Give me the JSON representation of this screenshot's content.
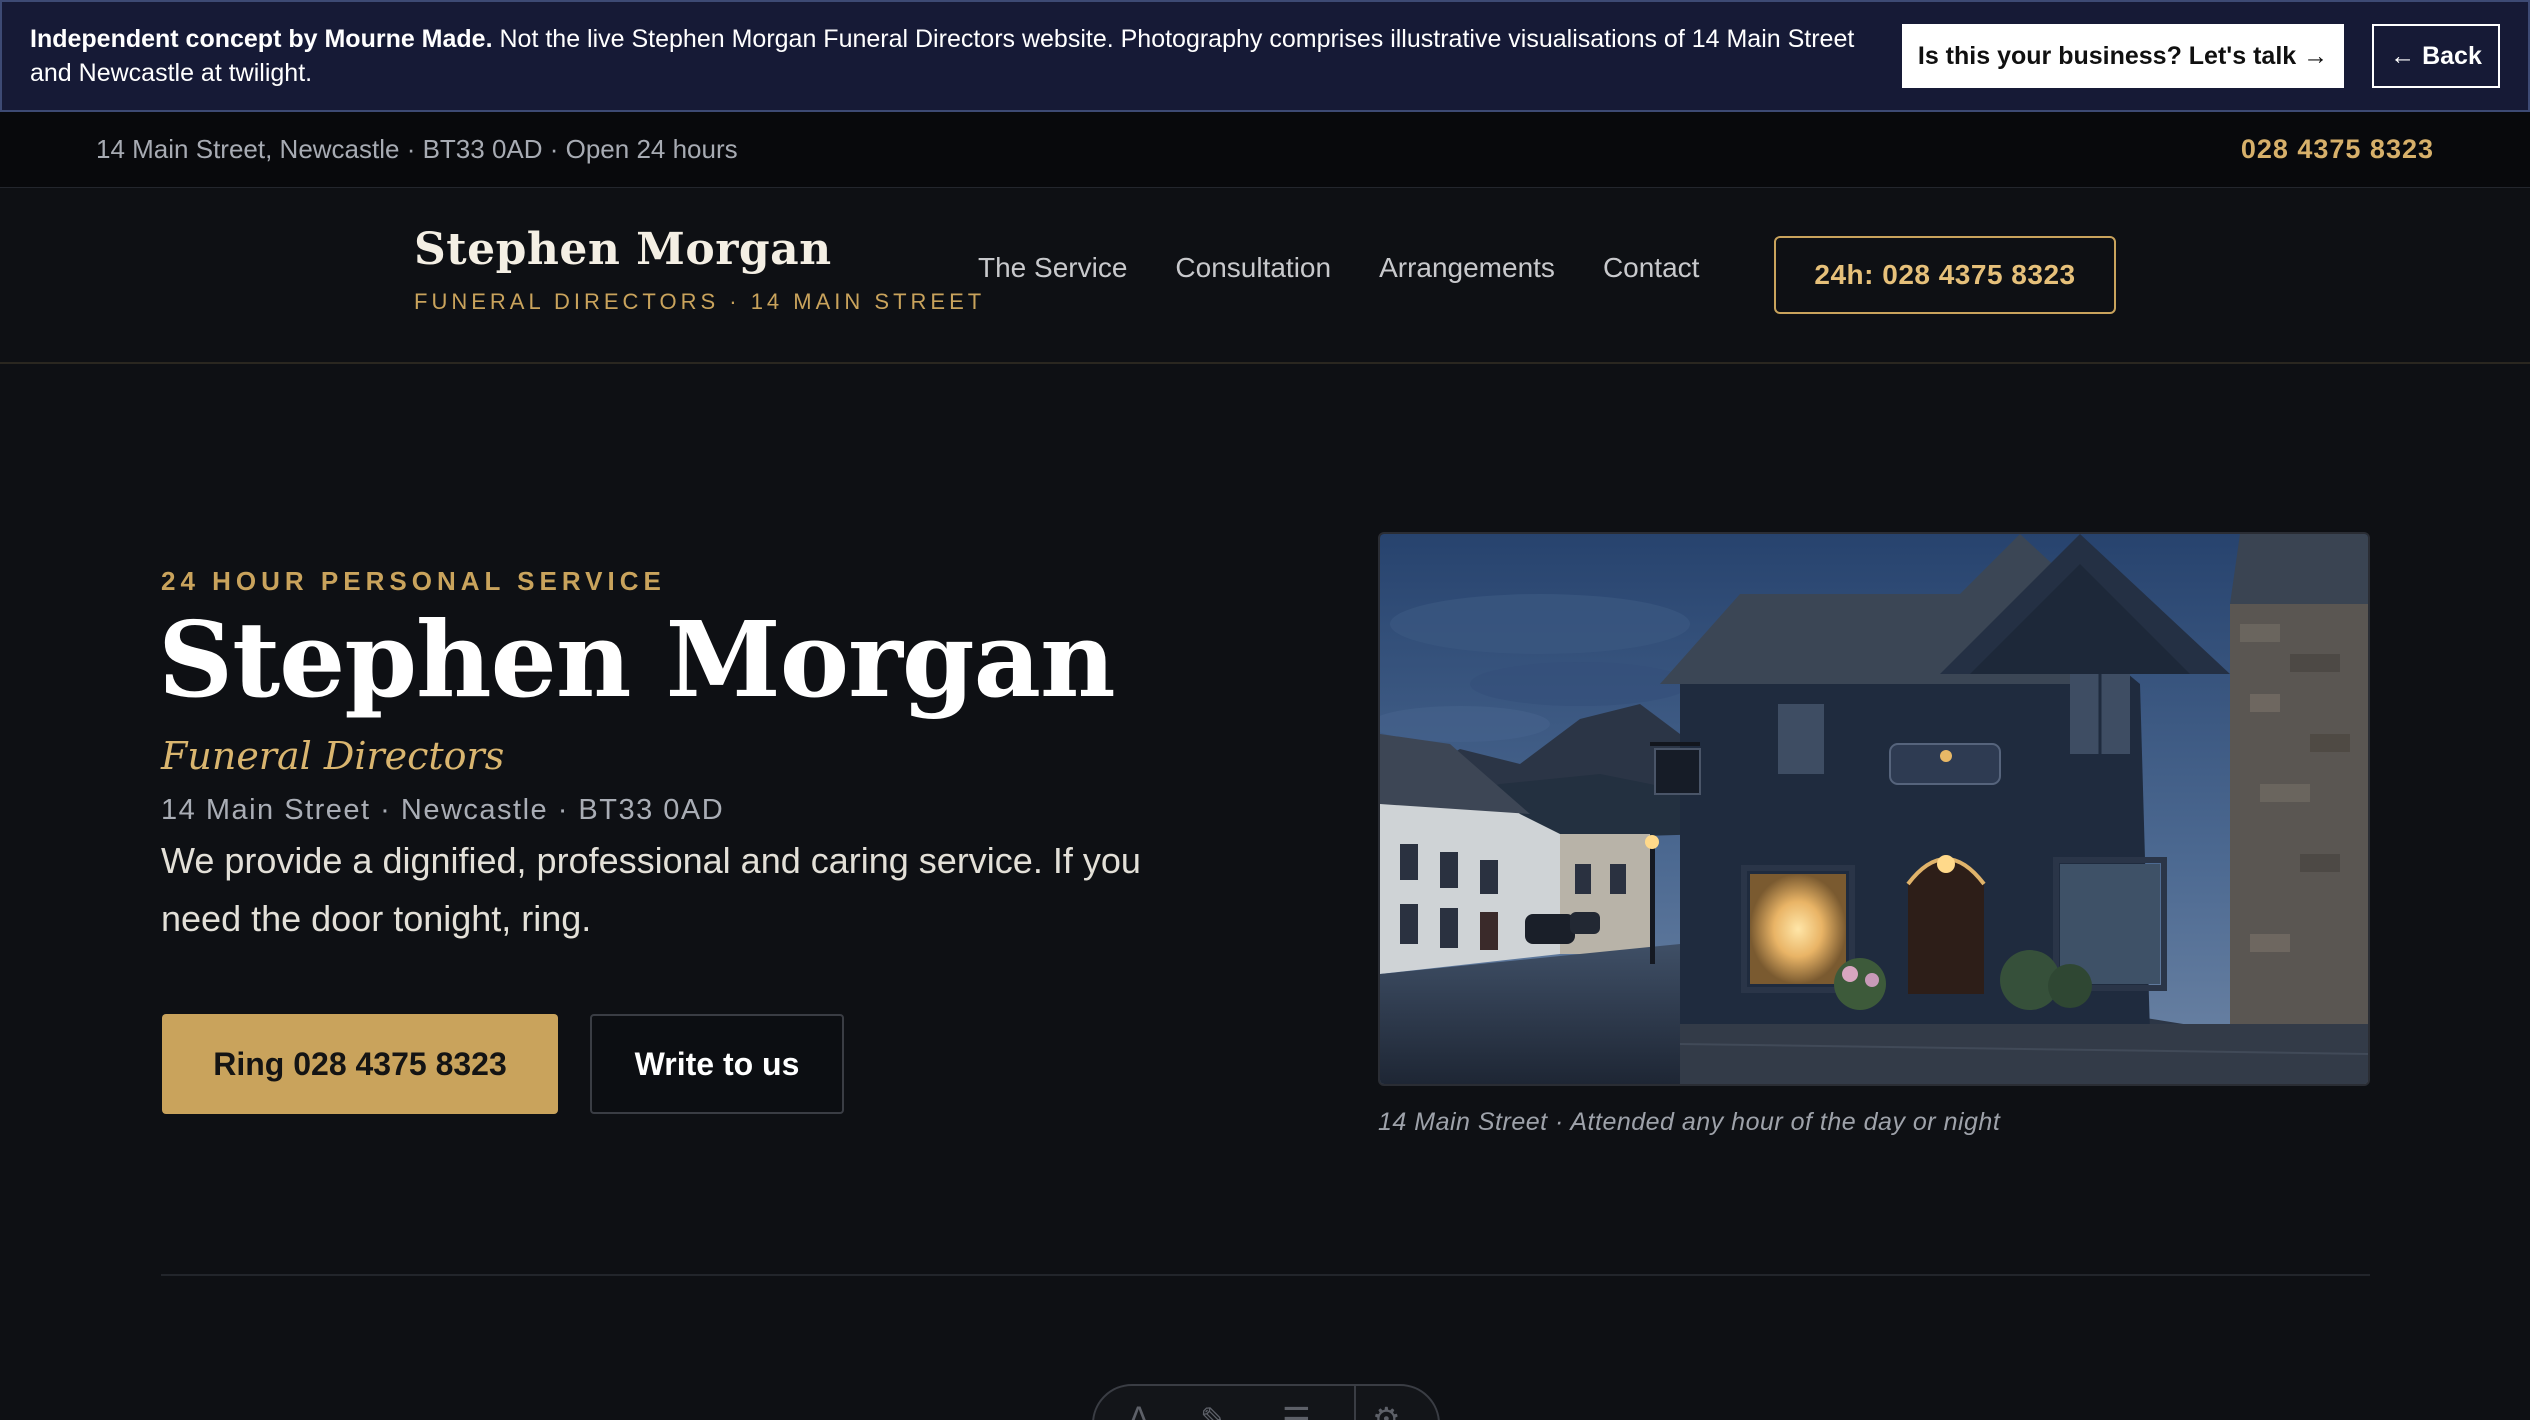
{
  "concept_bar": {
    "bold_text": "Independent concept by Mourne Made.",
    "text": " Not the live Stephen Morgan Funeral Directors website. Photography comprises illustrative visualisations of 14 Main Street and Newcastle at twilight.",
    "cta_label": "Is this your business? Let's talk →",
    "back_label": "← Back"
  },
  "info_bar": {
    "address": "14 Main Street, Newcastle · BT33 0AD · Open 24 hours",
    "phone": "028 4375 8323"
  },
  "nav": {
    "brand_name": "Stephen Morgan",
    "brand_tag": "FUNERAL DIRECTORS · 14 MAIN STREET",
    "links": [
      "The Service",
      "Consultation",
      "Arrangements",
      "Contact"
    ],
    "cta_label": "24h: 028 4375 8323"
  },
  "hero": {
    "eyebrow": "24 HOUR PERSONAL SERVICE",
    "title": "Stephen Morgan",
    "subtitle": "Funeral Directors",
    "address": "14 Main Street · Newcastle · BT33 0AD",
    "description": "We provide a dignified, professional and caring service. If you need the door tonight, ring.",
    "primary_button": "Ring 028 4375 8323",
    "secondary_button": "Write to us",
    "image_caption": "14 Main Street · Attended any hour of the day or night"
  },
  "colors": {
    "background": "#0e1014",
    "accent_gold": "#c9a35c",
    "banner_navy": "#161a36"
  },
  "toolbar": {
    "icons": [
      "text-icon",
      "brush-icon",
      "list-icon",
      "gear-icon"
    ]
  }
}
